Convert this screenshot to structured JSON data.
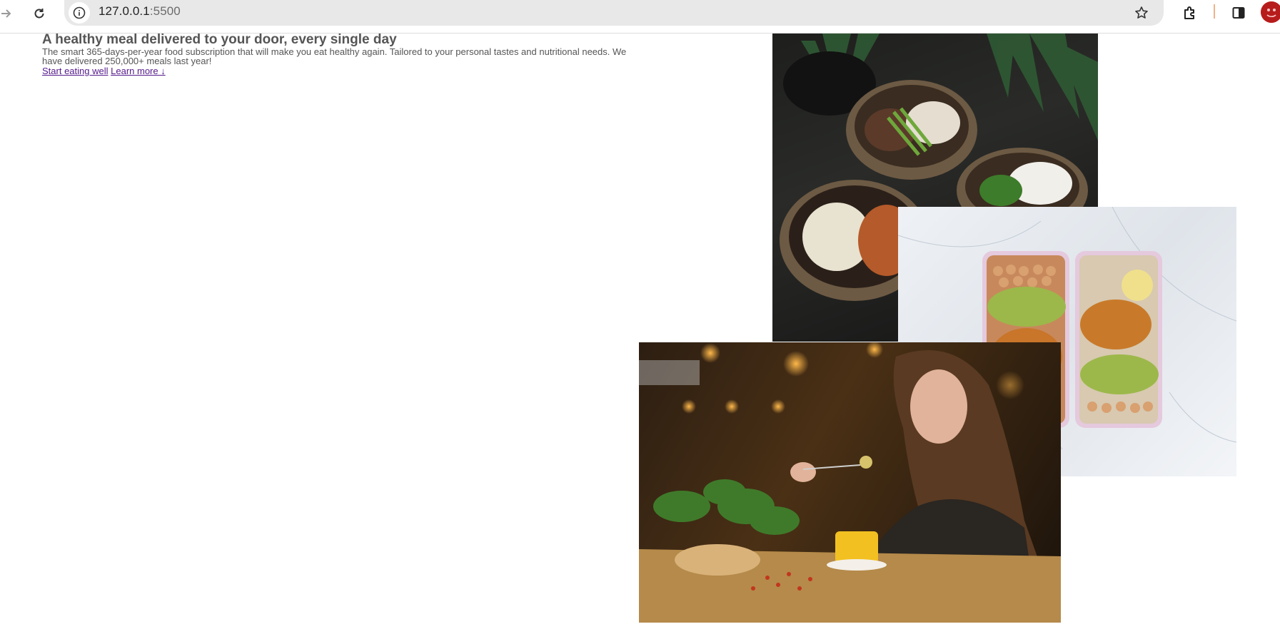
{
  "browser": {
    "url_host": "127.0.0.1",
    "url_port": ":5500",
    "icons": {
      "forward": "arrow-right-icon",
      "reload": "reload-icon",
      "site_info": "info-icon",
      "bookmark": "star-icon",
      "extensions": "puzzle-icon",
      "side_panel": "side-panel-icon",
      "profile": "avatar"
    },
    "colors": {
      "omnibox_bg": "#e8e8e8",
      "avatar_bg": "#c62828"
    }
  },
  "hero": {
    "title": "A healthy meal delivered to your door, every single day",
    "description": "The smart 365-days-per-year food subscription that will make you eat healthy again. Tailored to your personal tastes and nutritional needs. We have delivered 250,000+ meals last year!",
    "cta_primary": "Start eating well",
    "cta_secondary": "Learn more ↓",
    "link_color": "#551a8b"
  },
  "images": [
    {
      "id": "bowls",
      "subject": "food bowls on dark table"
    },
    {
      "id": "boxes",
      "subject": "meal prep boxes with chickpeas and avocado"
    },
    {
      "id": "woman",
      "subject": "woman eating in a cafe"
    }
  ]
}
